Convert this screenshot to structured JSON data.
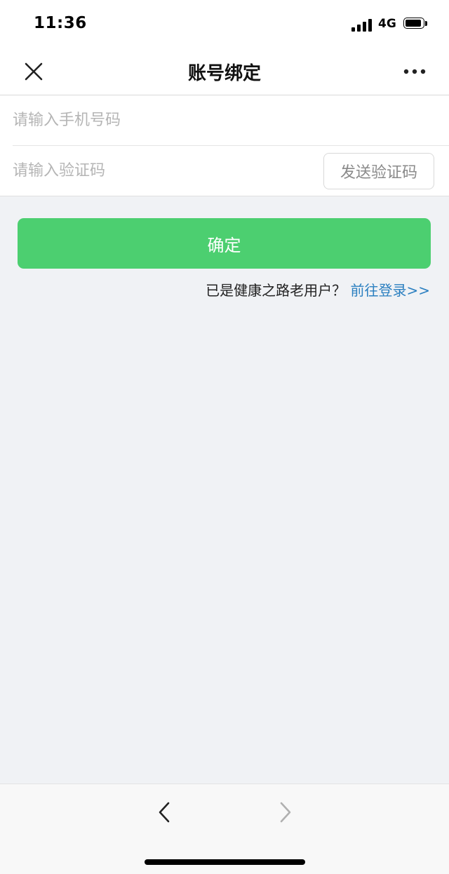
{
  "status_bar": {
    "time": "11:36",
    "network": "4G",
    "icons": [
      "signal-icon",
      "battery-icon"
    ]
  },
  "nav": {
    "title": "账号绑定",
    "close_icon": "close-icon",
    "more_icon": "more-icon"
  },
  "form": {
    "phone_placeholder": "请输入手机号码",
    "code_placeholder": "请输入验证码",
    "send_code_label": "发送验证码"
  },
  "confirm_label": "确定",
  "login_prompt": {
    "text": "已是健康之路老用户？",
    "link": "前往登录>>"
  },
  "bottom_nav": {
    "icons": [
      "back-arrow-icon",
      "forward-arrow-icon"
    ]
  },
  "colors": {
    "primary_button": "#4ccf70",
    "link": "#2a7fc0",
    "background": "#f0f2f5"
  }
}
